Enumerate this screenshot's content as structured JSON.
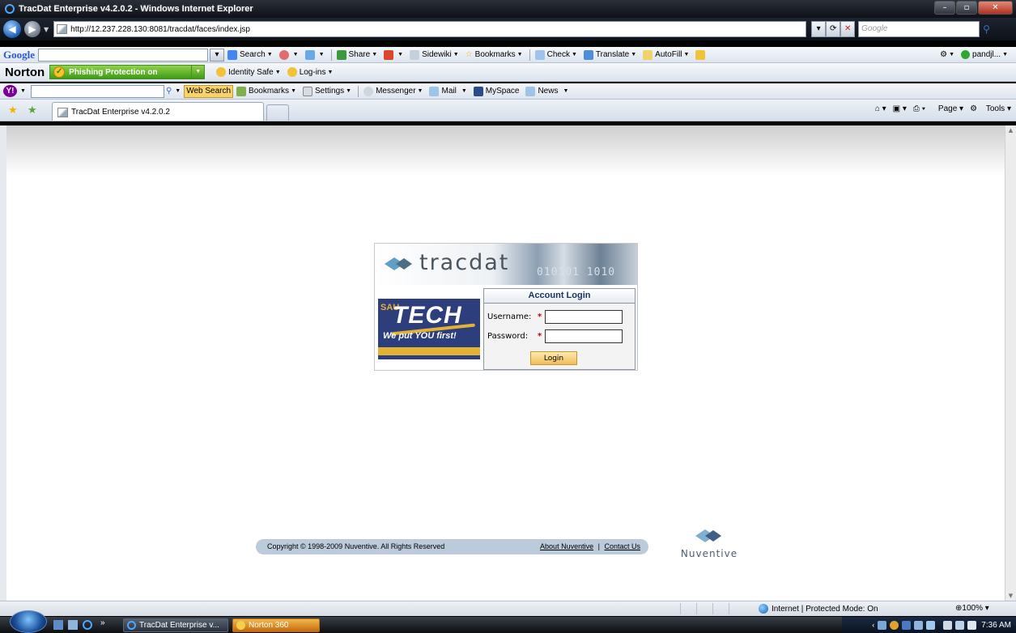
{
  "window": {
    "title": "TracDat Enterprise v4.2.0.2 - Windows Internet Explorer"
  },
  "address_bar": {
    "url": "http://12.237.228.130:8081/tracdat/faces/index.jsp",
    "search_placeholder": "Google"
  },
  "google_toolbar": {
    "logo": "Google",
    "items": [
      "Search",
      "Share",
      "Sidewiki",
      "Bookmarks",
      "Check",
      "Translate",
      "AutoFill"
    ],
    "user": "pandjl..."
  },
  "norton_toolbar": {
    "logo": "Norton",
    "phishing": "Phishing Protection on",
    "identity_safe": "Identity Safe",
    "logins": "Log-ins"
  },
  "yahoo_toolbar": {
    "logo": "Y!",
    "web_search": "Web Search",
    "items": [
      "Bookmarks",
      "Settings",
      "Messenger",
      "Mail",
      "MySpace",
      "News"
    ]
  },
  "tab": {
    "title": "TracDat Enterprise v4.2.0.2"
  },
  "command_bar": {
    "page": "Page",
    "tools": "Tools"
  },
  "login": {
    "brand": "tracdat",
    "brand_digits": "010101 1010",
    "sau": "SAU",
    "tech": "TECH",
    "motto": "We put YOU first!",
    "title": "Account Login",
    "username_label": "Username:",
    "password_label": "Password:",
    "required_mark": "*",
    "login_button": "Login"
  },
  "footer": {
    "copyright": "Copyright © 1998-2009 Nuventive. All Rights Reserved",
    "about": "About Nuventive",
    "separator": "|",
    "contact": "Contact Us",
    "logo_text": "Nuventive"
  },
  "status_bar": {
    "zone": "Internet | Protected Mode: On",
    "zoom": "100%"
  },
  "taskbar": {
    "ie_task": "TracDat Enterprise v...",
    "norton_task": "Norton 360",
    "clock": "7:36 AM"
  }
}
